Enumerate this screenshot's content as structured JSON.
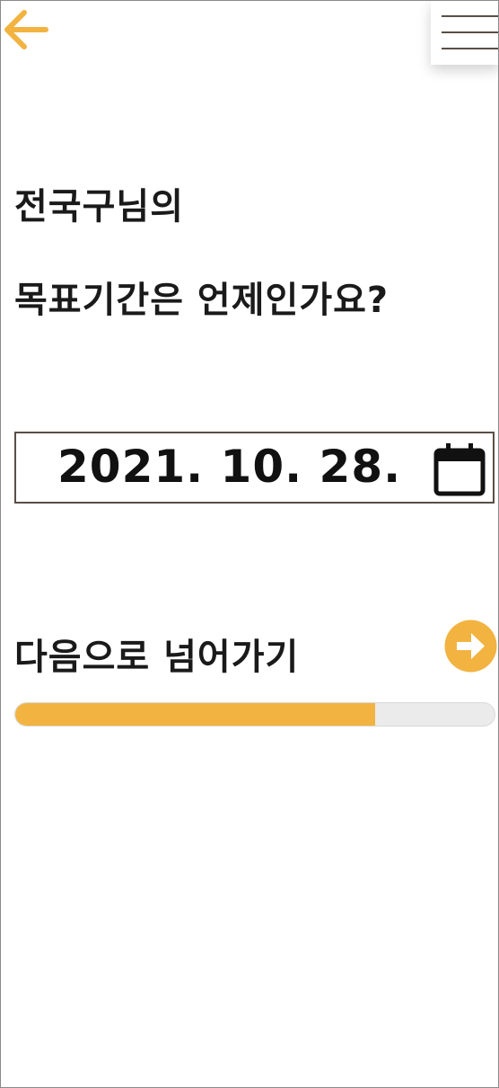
{
  "header": {
    "back_icon": "arrow-left-icon",
    "menu_icon": "hamburger-menu-icon"
  },
  "question": {
    "line1": "전국구님의",
    "line2": "목표기간은 언제인가요?"
  },
  "date_field": {
    "value": "2021. 10. 28.",
    "icon": "calendar-icon"
  },
  "next": {
    "label": "다음으로 넘어가기",
    "icon": "arrow-right-circle-icon"
  },
  "progress": {
    "fraction": 0.75
  },
  "colors": {
    "accent": "#f2b341",
    "border": "#5a4e44",
    "text": "#1a1a1a",
    "track": "#ebebeb"
  }
}
